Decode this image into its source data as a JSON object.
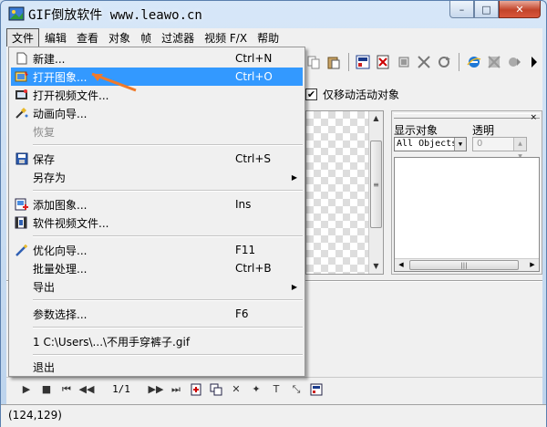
{
  "window": {
    "title": "GIF倒放软件 www.leawo.cn",
    "controls": {
      "minimize": "–",
      "maximize": "□",
      "close": "✕"
    }
  },
  "menubar": {
    "items": [
      "文件",
      "编辑",
      "查看",
      "对象",
      "帧",
      "过滤器",
      "视频 F/X",
      "帮助"
    ]
  },
  "file_menu": {
    "new": {
      "label": "新建...",
      "shortcut": "Ctrl+N",
      "icon": "new-document-icon"
    },
    "open_image": {
      "label": "打开图象...",
      "shortcut": "Ctrl+O",
      "icon": "open-image-icon"
    },
    "open_video": {
      "label": "打开视频文件...",
      "icon": "open-video-icon"
    },
    "animation_wizard": {
      "label": "动画向导...",
      "icon": "wizard-icon"
    },
    "restore": {
      "label": "恢复"
    },
    "save": {
      "label": "保存",
      "shortcut": "Ctrl+S",
      "icon": "save-disk-icon"
    },
    "save_as": {
      "label": "另存为",
      "arrow": "▶"
    },
    "add_image": {
      "label": "添加图象...",
      "shortcut": "Ins",
      "icon": "add-image-icon"
    },
    "video_file": {
      "label": "软件视频文件...",
      "icon": "video-file-icon"
    },
    "optimize_wizard": {
      "label": "优化向导...",
      "shortcut": "F11",
      "icon": "optimize-wand-icon"
    },
    "batch": {
      "label": "批量处理...",
      "shortcut": "Ctrl+B"
    },
    "export": {
      "label": "导出",
      "arrow": "▶"
    },
    "preferences": {
      "label": "参数选择...",
      "shortcut": "F6"
    },
    "recent1": {
      "label": "1 C:\\Users\\...\\不用手穿裤子.gif"
    },
    "exit": {
      "label": "退出"
    }
  },
  "options": {
    "move_active_only_label": "仅移动活动对象",
    "move_active_only_checked": "✔"
  },
  "object_panel": {
    "display_objects_label": "显示对象",
    "transparency_label": "透明",
    "object_select_value": "All Objects",
    "transparency_value": "0"
  },
  "playback": {
    "frame_counter": "1/1"
  },
  "status": {
    "coords": "(124,129)"
  },
  "colors": {
    "highlight": "#3399ff",
    "pointer": "#f07a2a",
    "menu_bg": "#f0f0f0"
  }
}
